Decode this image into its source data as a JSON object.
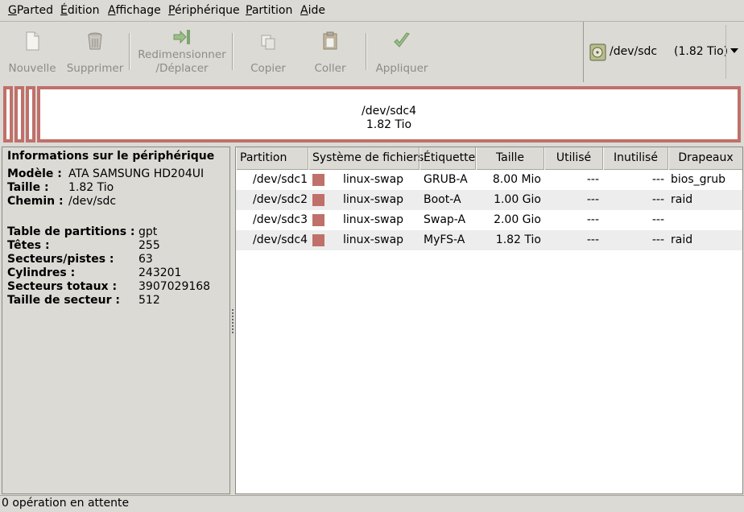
{
  "menu": {
    "items": [
      {
        "underlined": "G",
        "rest": "Parted"
      },
      {
        "underlined": "É",
        "rest": "dition"
      },
      {
        "underlined": "A",
        "rest": "ffichage"
      },
      {
        "underlined": "P",
        "rest": "ériphérique"
      },
      {
        "underlined": "P",
        "rest": "artition"
      },
      {
        "underlined": "A",
        "rest": "ide"
      }
    ]
  },
  "toolbar": {
    "new_label": "Nouvelle",
    "delete_label": "Supprimer",
    "resize_label_line1": "Redimensionner",
    "resize_label_line2": "/Déplacer",
    "copy_label": "Copier",
    "paste_label": "Coller",
    "apply_label": "Appliquer",
    "device": {
      "name": "/dev/sdc",
      "size": "(1.82 Tio)"
    }
  },
  "diskmap": {
    "selected_name": "/dev/sdc4",
    "selected_size": "1.82 Tio",
    "partition_color": "#c0706a"
  },
  "info": {
    "title": "Informations sur le périphérique",
    "model_key": "Modèle :",
    "model_val": "ATA SAMSUNG HD204UI",
    "size_key": "Taille :",
    "size_val": "1.82 Tio",
    "path_key": "Chemin :",
    "path_val": "/dev/sdc",
    "ptable_key": "Table de partitions :",
    "ptable_val": "gpt",
    "heads_key": "Têtes :",
    "heads_val": "255",
    "sectors_track_key": "Secteurs/pistes :",
    "sectors_track_val": "63",
    "cylinders_key": "Cylindres :",
    "cylinders_val": "243201",
    "total_sectors_key": "Secteurs totaux :",
    "total_sectors_val": "3907029168",
    "sector_size_key": "Taille de secteur :",
    "sector_size_val": "512"
  },
  "table": {
    "headers": [
      "Partition",
      "Système de fichiers",
      "Étiquette",
      "Taille",
      "Utilisé",
      "Inutilisé",
      "Drapeaux"
    ],
    "rows": [
      {
        "partition": "/dev/sdc1",
        "fs": "linux-swap",
        "label": "GRUB-A",
        "size": "8.00 Mio",
        "used": "---",
        "unused": "---",
        "flags": "bios_grub"
      },
      {
        "partition": "/dev/sdc2",
        "fs": "linux-swap",
        "label": "Boot-A",
        "size": "1.00 Gio",
        "used": "---",
        "unused": "---",
        "flags": "raid"
      },
      {
        "partition": "/dev/sdc3",
        "fs": "linux-swap",
        "label": "Swap-A",
        "size": "2.00 Gio",
        "used": "---",
        "unused": "---",
        "flags": ""
      },
      {
        "partition": "/dev/sdc4",
        "fs": "linux-swap",
        "label": "MyFS-A",
        "size": "1.82 Tio",
        "used": "---",
        "unused": "---",
        "flags": "raid"
      }
    ]
  },
  "status": {
    "text": "0 opération en attente"
  }
}
